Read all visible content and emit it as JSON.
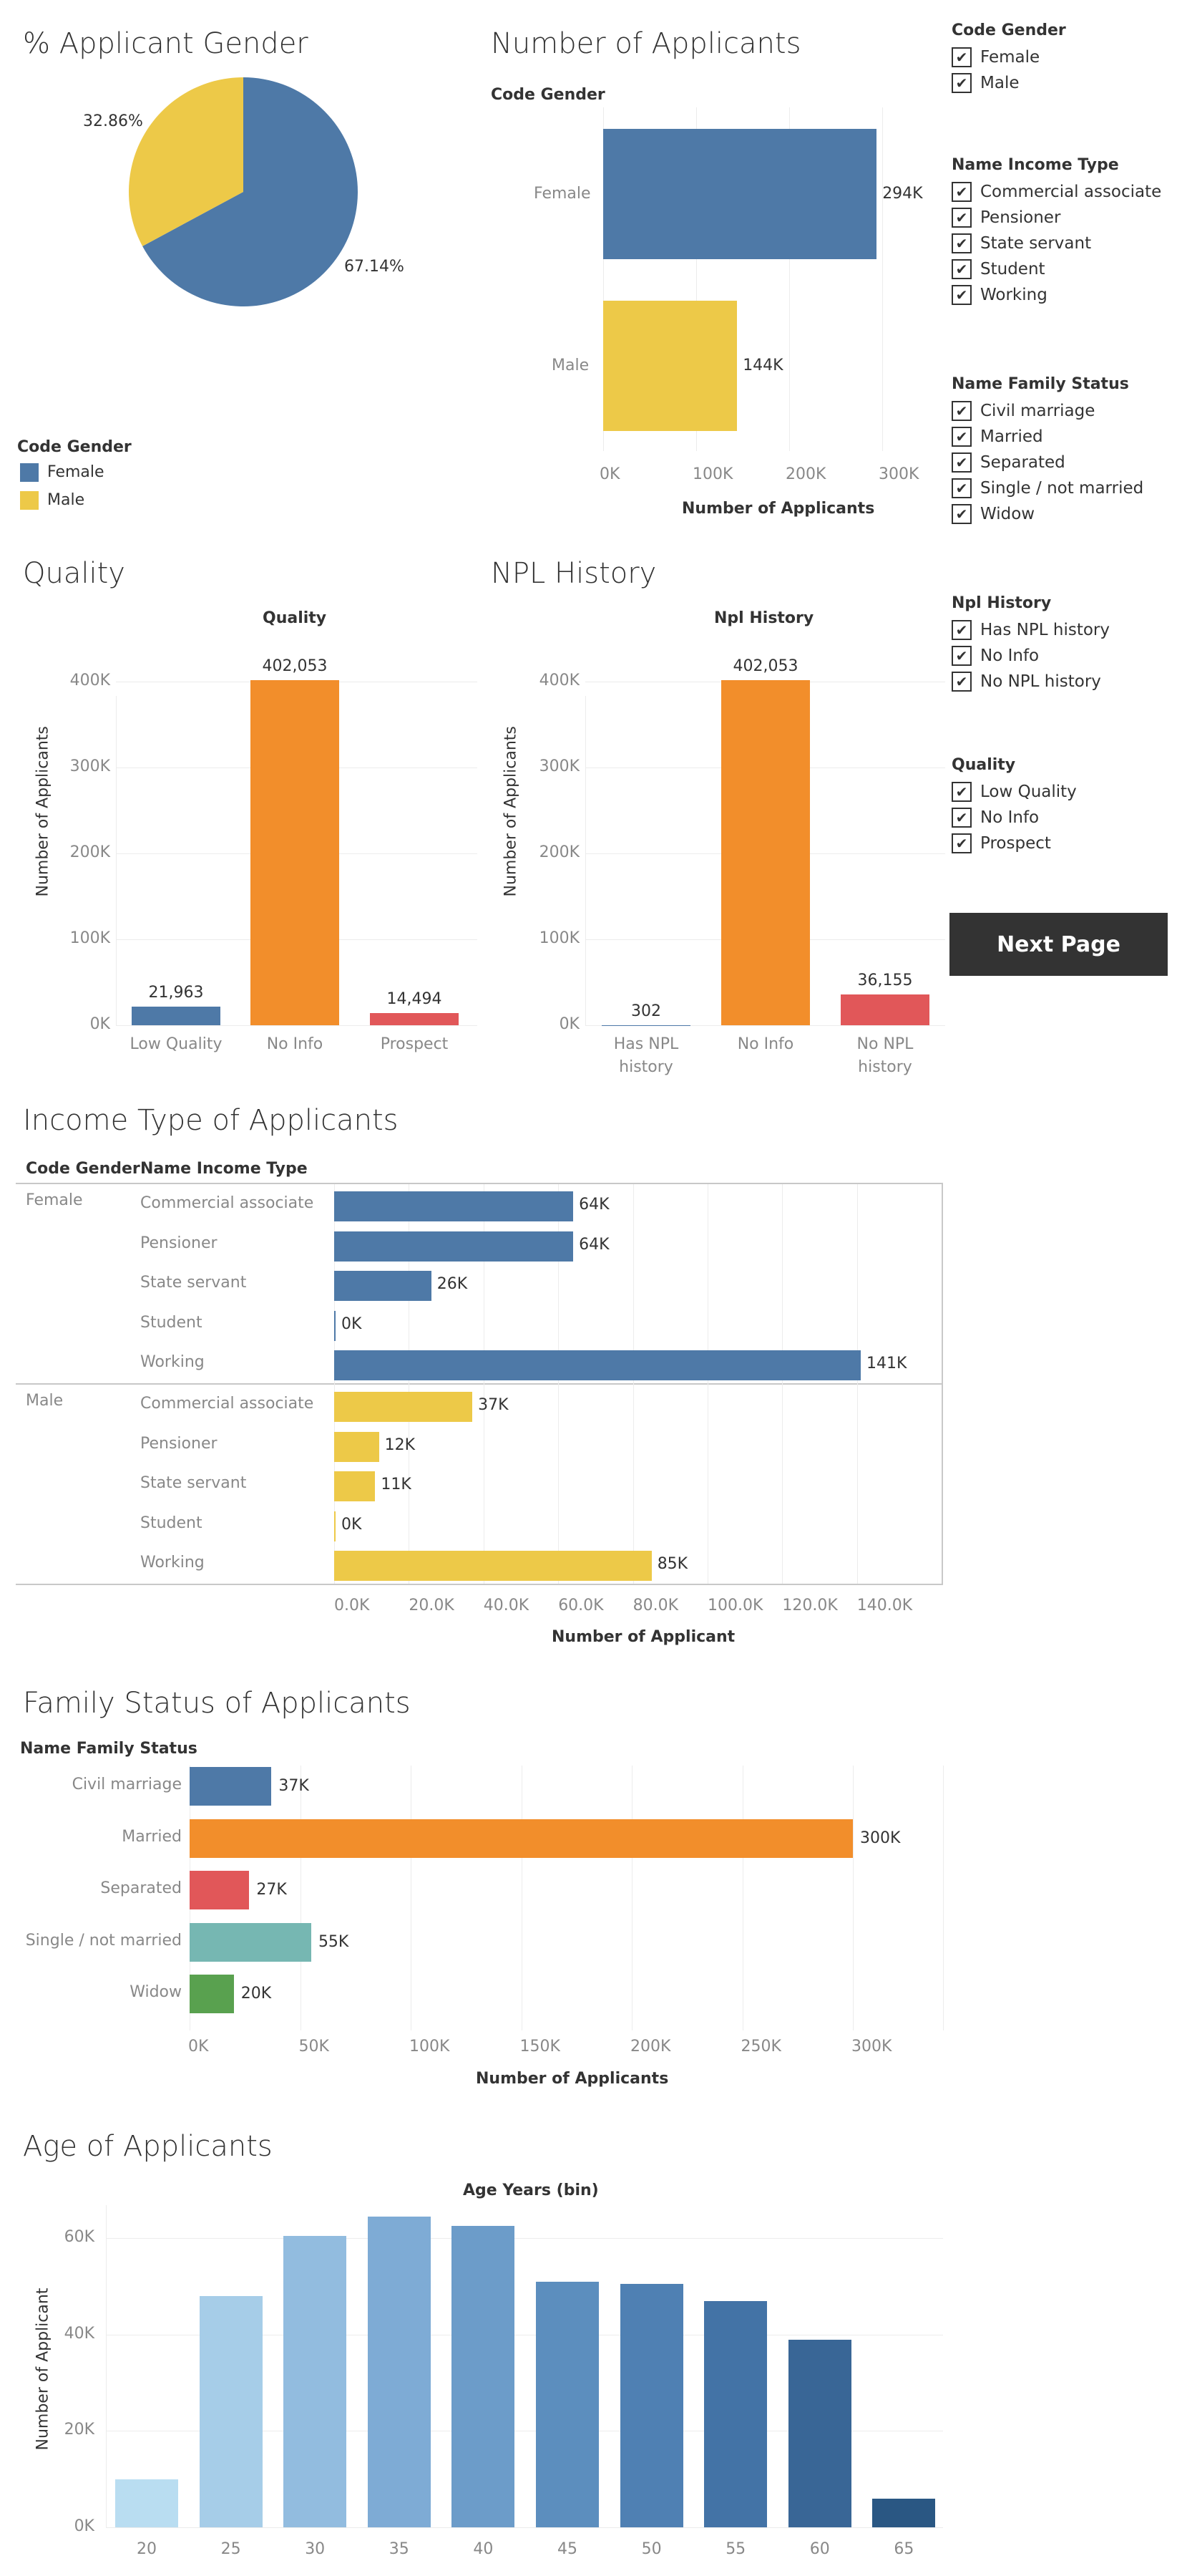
{
  "pie": {
    "title": "% Applicant Gender",
    "slices": [
      {
        "label": "67.14%",
        "value": 67.14,
        "color": "#4e79a7"
      },
      {
        "label": "32.86%",
        "value": 32.86,
        "color": "#edc948"
      }
    ],
    "legend_title": "Code Gender",
    "legend": [
      {
        "label": "Female",
        "color": "#4e79a7"
      },
      {
        "label": "Male",
        "color": "#edc948"
      }
    ]
  },
  "applicants": {
    "title": "Number of Applicants",
    "axis_title": "Code Gender",
    "xlabel": "Number of Applicants",
    "ticks": [
      "0K",
      "100K",
      "200K",
      "300K"
    ],
    "bars": [
      {
        "category": "Female",
        "value": 294,
        "label": "294K",
        "color": "#4e79a7"
      },
      {
        "category": "Male",
        "value": 144,
        "label": "144K",
        "color": "#edc948"
      }
    ]
  },
  "quality": {
    "title": "Quality",
    "chart_title": "Quality",
    "ylabel": "Number of Applicants",
    "ticks": [
      "400K",
      "300K",
      "200K",
      "100K",
      "0K"
    ],
    "bars": [
      {
        "category": "Low Quality",
        "value": 21963,
        "label": "21,963",
        "color": "#4e79a7"
      },
      {
        "category": "No Info",
        "value": 402053,
        "label": "402,053",
        "color": "#f28e2b"
      },
      {
        "category": "Prospect",
        "value": 14494,
        "label": "14,494",
        "color": "#e15759"
      }
    ]
  },
  "npl": {
    "title": "NPL History",
    "chart_title": "Npl History",
    "ylabel": "Number of Applicants",
    "ticks": [
      "400K",
      "300K",
      "200K",
      "100K",
      "0K"
    ],
    "bars": [
      {
        "category_line1": "Has NPL",
        "category_line2": "history",
        "value": 302,
        "label": "302",
        "color": "#4e79a7"
      },
      {
        "category_line1": "No Info",
        "category_line2": "",
        "value": 402053,
        "label": "402,053",
        "color": "#f28e2b"
      },
      {
        "category_line1": "No NPL",
        "category_line2": "history",
        "value": 36155,
        "label": "36,155",
        "color": "#e15759"
      }
    ]
  },
  "filters": {
    "gender": {
      "title": "Code Gender",
      "options": [
        "Female",
        "Male"
      ]
    },
    "income": {
      "title": "Name Income Type",
      "options": [
        "Commercial associate",
        "Pensioner",
        "State servant",
        "Student",
        "Working"
      ]
    },
    "family": {
      "title": "Name Family Status",
      "options": [
        "Civil marriage",
        "Married",
        "Separated",
        "Single / not married",
        "Widow"
      ]
    },
    "npl": {
      "title": "Npl History",
      "options": [
        "Has NPL history",
        "No Info",
        "No NPL history"
      ]
    },
    "quality": {
      "title": "Quality",
      "options": [
        "Low Quality",
        "No Info",
        "Prospect"
      ]
    },
    "check_mark": "✔"
  },
  "next_button": "Next Page",
  "income": {
    "title": "Income Type of Applicants",
    "col1": "Code Gender",
    "col2": "Name Income Type",
    "xlabel": "Number of Applicant",
    "ticks": [
      "0.0K",
      "20.0K",
      "40.0K",
      "60.0K",
      "80.0K",
      "100.0K",
      "120.0K",
      "140.0K"
    ],
    "groups": [
      {
        "gender": "Female",
        "color": "#4e79a7",
        "rows": [
          {
            "type": "Commercial associate",
            "value": 64,
            "label": "64K"
          },
          {
            "type": "Pensioner",
            "value": 64,
            "label": "64K"
          },
          {
            "type": "State servant",
            "value": 26,
            "label": "26K"
          },
          {
            "type": "Student",
            "value": 0,
            "label": "0K"
          },
          {
            "type": "Working",
            "value": 141,
            "label": "141K"
          }
        ]
      },
      {
        "gender": "Male",
        "color": "#edc948",
        "rows": [
          {
            "type": "Commercial associate",
            "value": 37,
            "label": "37K"
          },
          {
            "type": "Pensioner",
            "value": 12,
            "label": "12K"
          },
          {
            "type": "State servant",
            "value": 11,
            "label": "11K"
          },
          {
            "type": "Student",
            "value": 0,
            "label": "0K"
          },
          {
            "type": "Working",
            "value": 85,
            "label": "85K"
          }
        ]
      }
    ]
  },
  "family": {
    "title": "Family Status of Applicants",
    "axis_title": "Name Family Status",
    "xlabel": "Number of Applicants",
    "ticks": [
      "0K",
      "50K",
      "100K",
      "150K",
      "200K",
      "250K",
      "300K"
    ],
    "bars": [
      {
        "category": "Civil marriage",
        "value": 37,
        "label": "37K",
        "color": "#4e79a7"
      },
      {
        "category": "Married",
        "value": 300,
        "label": "300K",
        "color": "#f28e2b"
      },
      {
        "category": "Separated",
        "value": 27,
        "label": "27K",
        "color": "#e15759"
      },
      {
        "category": "Single / not married",
        "value": 55,
        "label": "55K",
        "color": "#76b7b2"
      },
      {
        "category": "Widow",
        "value": 20,
        "label": "20K",
        "color": "#59a14f"
      }
    ]
  },
  "age": {
    "title": "Age of Applicants",
    "chart_title": "Age Years (bin)",
    "ylabel": "Number of Applicant",
    "ticks": [
      "60K",
      "40K",
      "20K",
      "0K"
    ],
    "bars": [
      {
        "category": "20",
        "value": 10,
        "color": "#b9ddf1"
      },
      {
        "category": "25",
        "value": 48,
        "color": "#a6cde8"
      },
      {
        "category": "30",
        "value": 60.5,
        "color": "#92bcdf"
      },
      {
        "category": "35",
        "value": 64.5,
        "color": "#7eabd5"
      },
      {
        "category": "40",
        "value": 62.5,
        "color": "#6c9cc9"
      },
      {
        "category": "45",
        "value": 51,
        "color": "#5c8ebe"
      },
      {
        "category": "50",
        "value": 50.5,
        "color": "#4f80b3"
      },
      {
        "category": "55",
        "value": 47,
        "color": "#4373a6"
      },
      {
        "category": "60",
        "value": 39,
        "color": "#396696"
      },
      {
        "category": "65",
        "value": 6,
        "color": "#2a5783"
      }
    ]
  }
}
